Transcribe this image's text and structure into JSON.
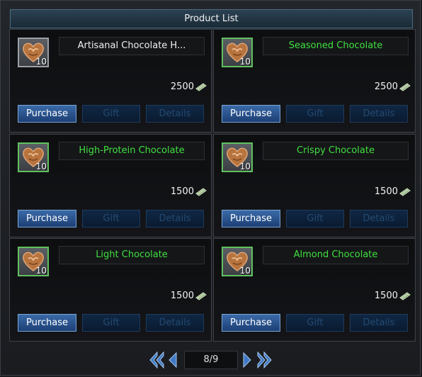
{
  "window": {
    "title": "Product List"
  },
  "labels": {
    "purchase": "Purchase",
    "gift": "Gift",
    "details": "Details"
  },
  "products": [
    {
      "name": "Artisanal Chocolate H...",
      "quantity": "10",
      "price": "2500",
      "highlight": false,
      "icon": "chocolate-heart-icon"
    },
    {
      "name": "Seasoned Chocolate",
      "quantity": "10",
      "price": "2500",
      "highlight": true,
      "icon": "chocolate-heart-icon"
    },
    {
      "name": "High-Protein Chocolate",
      "quantity": "10",
      "price": "1500",
      "highlight": true,
      "icon": "chocolate-heart-icon"
    },
    {
      "name": "Crispy Chocolate",
      "quantity": "10",
      "price": "1500",
      "highlight": true,
      "icon": "chocolate-heart-icon"
    },
    {
      "name": "Light Chocolate",
      "quantity": "10",
      "price": "1500",
      "highlight": true,
      "icon": "chocolate-heart-icon"
    },
    {
      "name": "Almond Chocolate",
      "quantity": "10",
      "price": "1500",
      "highlight": true,
      "icon": "chocolate-heart-icon"
    }
  ],
  "pagination": {
    "page_display": "8/9"
  },
  "colors": {
    "highlight_text": "#3fe03f",
    "accent_blue": "#3a6aa8",
    "disabled_text": "#234a72"
  }
}
